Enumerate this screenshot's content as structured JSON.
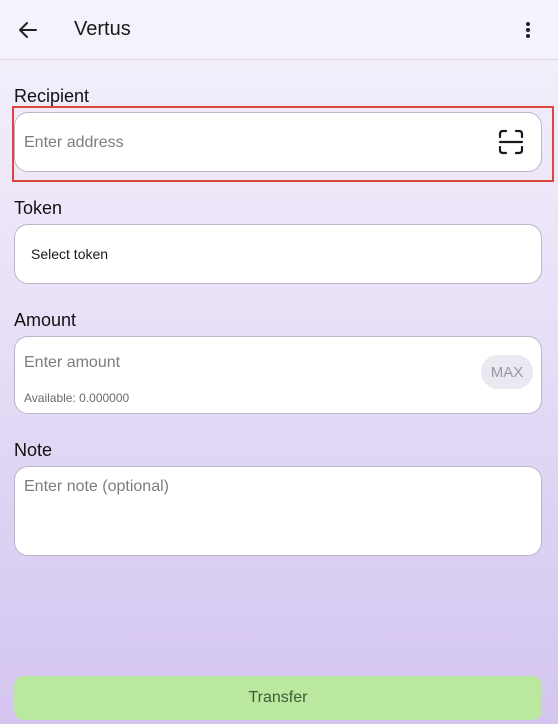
{
  "app_bar": {
    "title": "Vertus",
    "back_icon": "arrow-left-icon",
    "menu_icon": "more-vertical-icon"
  },
  "recipient": {
    "label": "Recipient",
    "placeholder": "Enter address",
    "scan_icon": "scan-qr-icon",
    "highlighted": true,
    "highlight_color": "#d9473f"
  },
  "token": {
    "label": "Token",
    "value": "Select token"
  },
  "amount": {
    "label": "Amount",
    "placeholder": "Enter amount",
    "available": "Available: 0.000000",
    "max_label": "MAX"
  },
  "note": {
    "label": "Note",
    "placeholder": "Enter note (optional)"
  },
  "transfer": {
    "label": "Transfer",
    "color": "#b9e89e"
  }
}
